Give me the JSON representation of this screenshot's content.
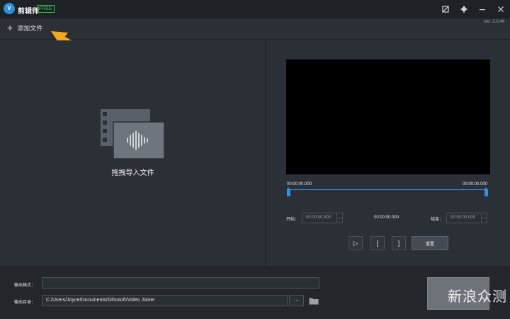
{
  "app": {
    "logo_text": "V",
    "title": "剪辑师",
    "badge": "FREE",
    "version": "Ver: 2.0.46"
  },
  "window_controls": [
    "skin-icon",
    "gear-icon",
    "minimize-icon",
    "close-icon"
  ],
  "toolbar": {
    "add_label": "添加文件"
  },
  "drop_zone": {
    "label": "拖拽导入文件",
    "icon": "film-audio-icon"
  },
  "preview": {
    "time_left": "00:00:00.000",
    "time_right": "00:00:00.000",
    "start_label": "开始：",
    "start_value": "00:00:00.000",
    "duration_value": "00:00:00.000",
    "end_label": "结束：",
    "end_value": "00:00:00.000",
    "play_label": "▷",
    "mark_in_label": "[",
    "mark_out_label": "]",
    "reset_label": "重置"
  },
  "output": {
    "format_label": "输出格式：",
    "format_value": "",
    "dir_label": "输出目录：",
    "dir_value": "C:/Users/Joyce/Documents/Gihosoft/Video Joiner",
    "browse_label": "..."
  },
  "watermark": "新浪众测",
  "colors": {
    "accent": "#2d8fe6",
    "arrow": "#f2a91c",
    "badge": "#3fbf4a"
  }
}
